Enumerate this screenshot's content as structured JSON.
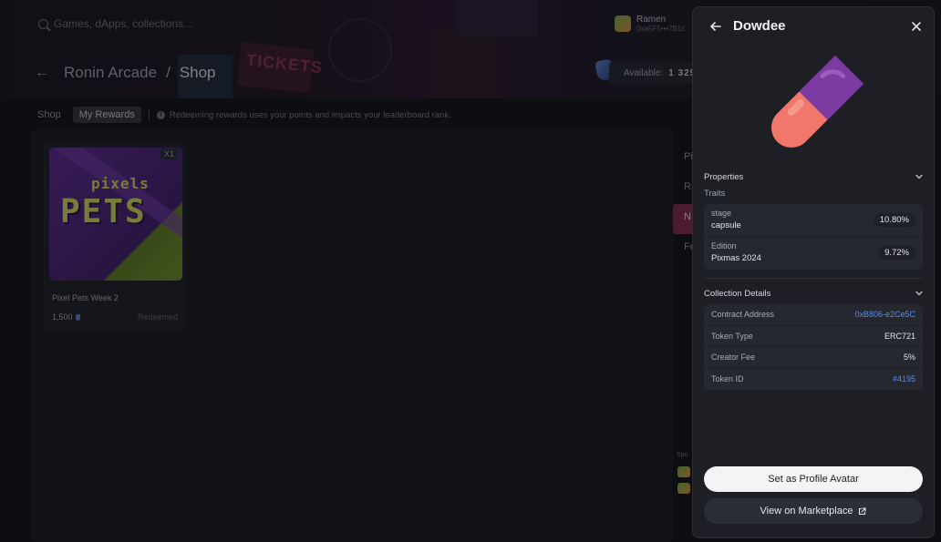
{
  "search": {
    "placeholder": "Games, dApps, collections..."
  },
  "user": {
    "name": "Ramen",
    "address": "0xa5F5•••7B1c"
  },
  "breadcrumb": {
    "root": "Ronin Arcade",
    "separator": "/",
    "current": "Shop"
  },
  "balance": {
    "label": "Available:",
    "value": "1 325"
  },
  "tabs": [
    {
      "label": "Shop"
    },
    {
      "label": "My Rewards"
    }
  ],
  "notice": "Redeeming rewards uses your points and impacts your leaderboard rank.",
  "reward_card": {
    "quantity": "X1",
    "art_top": "pixels",
    "art_main": "PETS",
    "title": "Pixel Pets Week 2",
    "price": "1,500",
    "status": "Redeemed"
  },
  "side_items": [
    {
      "label": "Pi"
    },
    {
      "label": "Ra"
    },
    {
      "label": "N"
    },
    {
      "label": "Fe"
    }
  ],
  "sponsor_label": "Spo",
  "drawer": {
    "title": "Dowdee",
    "properties": {
      "heading": "Properties",
      "traits_label": "Traits",
      "traits": [
        {
          "name": "stage",
          "value": "capsule",
          "percent": "10.80%"
        },
        {
          "name": "Edition",
          "value": "Pixmas 2024",
          "percent": "9.72%"
        }
      ]
    },
    "collection": {
      "heading": "Collection Details",
      "rows": [
        {
          "key": "Contract Address",
          "value": "0xB806-e2Ce5C"
        },
        {
          "key": "Token Type",
          "value": "ERC721"
        },
        {
          "key": "Creator Fee",
          "value": "5%"
        },
        {
          "key": "Token ID",
          "value": "#4195"
        }
      ]
    },
    "actions": {
      "primary": "Set as Profile Avatar",
      "secondary": "View on Marketplace"
    }
  },
  "colors": {
    "link": "#5a8be8",
    "highlight": "#7a2a4e",
    "pill_top": "#7c3aa3",
    "pill_bottom": "#f0776a"
  }
}
